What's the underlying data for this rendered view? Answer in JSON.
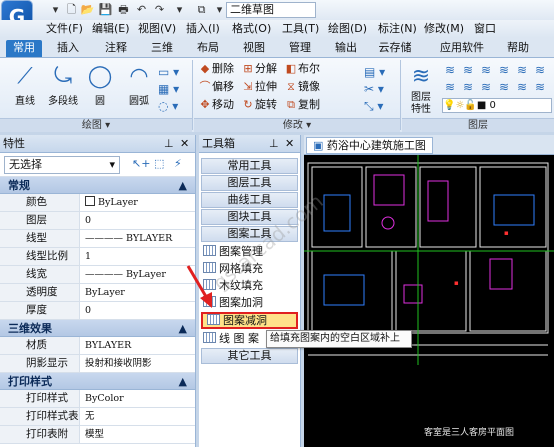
{
  "title_bar": {
    "document_name": "二维草图"
  },
  "menu": [
    "文件(F)",
    "编辑(E)",
    "视图(V)",
    "插入(I)",
    "格式(O)",
    "工具(T)",
    "绘图(D)",
    "标注(N)",
    "修改(M)",
    "窗口"
  ],
  "ribbon_tabs": [
    "常用",
    "插入",
    "注释",
    "三维",
    "布局",
    "视图",
    "管理",
    "输出",
    "云存储",
    "应用软件",
    "帮助"
  ],
  "active_tab": "常用",
  "draw_group": {
    "label": "绘图",
    "buttons": [
      "直线",
      "多段线",
      "圆",
      "圆弧"
    ]
  },
  "modify_group": {
    "label": "修改",
    "rows": [
      [
        "删除",
        "分解",
        "布尔"
      ],
      [
        "偏移",
        "拉伸",
        "镜像"
      ],
      [
        "移动",
        "旋转",
        "复制"
      ]
    ]
  },
  "layer_group": {
    "label": "图层",
    "button": "图层特性",
    "current_layer": "0"
  },
  "properties": {
    "title": "特性",
    "selection": "无选择",
    "sections": {
      "general": {
        "title": "常规",
        "rows": [
          {
            "key": "颜色",
            "value": "ByLayer"
          },
          {
            "key": "图层",
            "value": "0"
          },
          {
            "key": "线型",
            "value": "———— BYLAYER"
          },
          {
            "key": "线型比例",
            "value": "1"
          },
          {
            "key": "线宽",
            "value": "———— ByLayer"
          },
          {
            "key": "透明度",
            "value": "ByLayer"
          },
          {
            "key": "厚度",
            "value": "0"
          }
        ]
      },
      "3d": {
        "title": "三维效果",
        "rows": [
          {
            "key": "材质",
            "value": "BYLAYER"
          },
          {
            "key": "阴影显示",
            "value": "投射和接收阴影"
          }
        ]
      },
      "print": {
        "title": "打印样式",
        "rows": [
          {
            "key": "打印样式",
            "value": "ByColor"
          },
          {
            "key": "打印样式表",
            "value": "无"
          },
          {
            "key": "打印表附",
            "value": "模型"
          }
        ]
      }
    }
  },
  "toolbox": {
    "title": "工具箱",
    "categories": [
      "常用工具",
      "图层工具",
      "曲线工具",
      "图块工具",
      "图案工具"
    ],
    "items": [
      "图案管理",
      "网格填充",
      "木纹填充",
      "图案加洞",
      "图案减洞",
      "线 图 案"
    ],
    "selected_item": "图案减洞",
    "last_category": "其它工具"
  },
  "drawing": {
    "tab_title": "药浴中心建筑施工图",
    "caption": "客室是三人客房平面图"
  },
  "tooltip": "给填充图案内的空白区域补上",
  "watermark": "gstarcad.com",
  "colors": {
    "accent": "#2b78c7",
    "highlight_border": "#e02020"
  }
}
